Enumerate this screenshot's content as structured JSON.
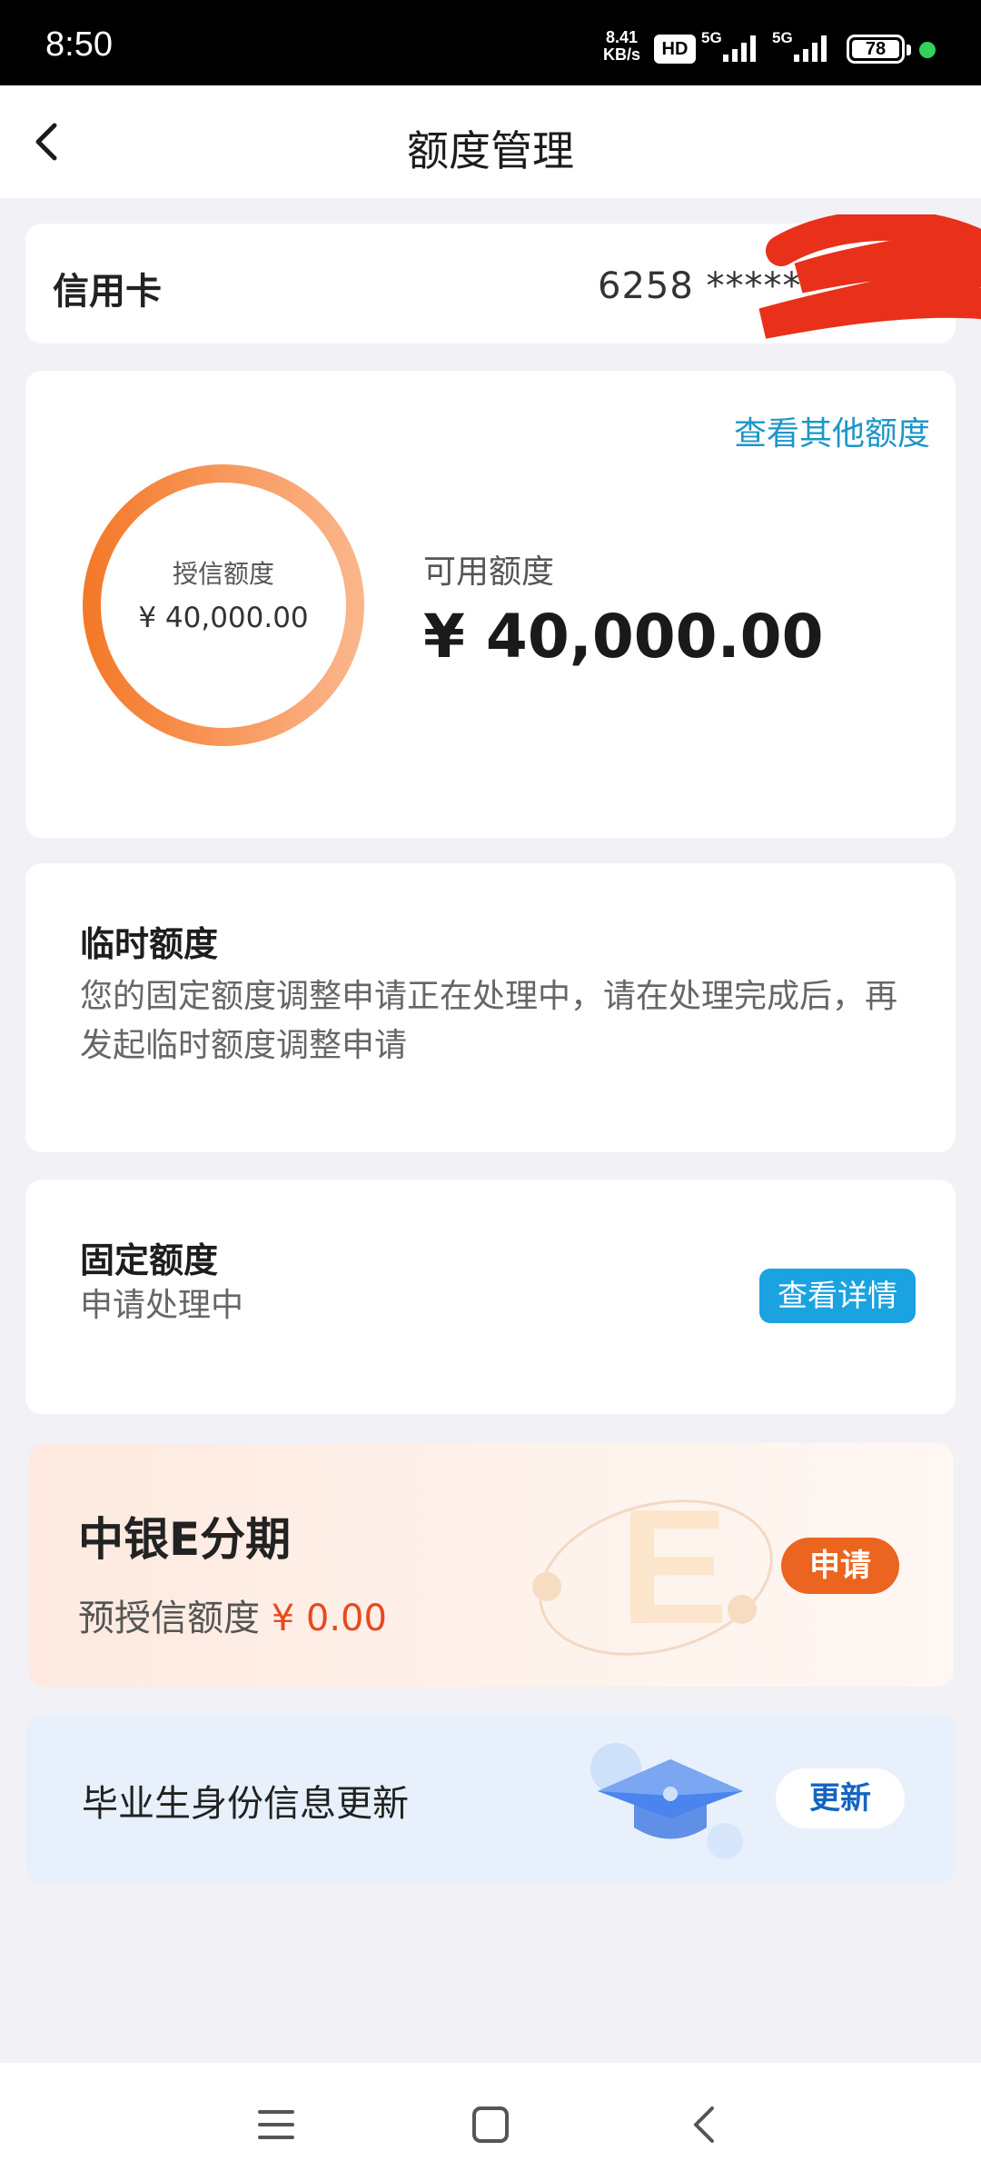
{
  "status_bar": {
    "time": "8:50",
    "net_speed_value": "8.41",
    "net_speed_unit": "KB/s",
    "hd_label": "HD",
    "signal1": "5G",
    "signal2": "5G",
    "battery": "78"
  },
  "header": {
    "title": "额度管理",
    "back_icon": "chevron-left-icon"
  },
  "account": {
    "label": "信用卡",
    "number": "6258 ******"
  },
  "quota": {
    "other_link": "查看其他额度",
    "credit_label": "授信额度",
    "credit_value": "¥ 40,000.00",
    "available_label": "可用额度",
    "available_value": "¥ 40,000.00",
    "ring_color": "#f58a3c"
  },
  "temporary": {
    "title": "临时额度",
    "description": "您的固定额度调整申请正在处理中，请在处理完成后，再发起临时额度调整申请"
  },
  "fixed": {
    "title": "固定额度",
    "status": "申请处理中",
    "detail_button": "查看详情"
  },
  "installment": {
    "title": "中银E分期",
    "pre_credit_label": "预授信额度",
    "pre_credit_value": "¥ 0.00",
    "apply_button": "申请"
  },
  "graduate": {
    "title": "毕业生身份信息更新",
    "update_button": "更新"
  },
  "nav": {
    "menu_icon": "menu-icon",
    "home_icon": "home-square-icon",
    "back_icon": "back-chevron-icon"
  }
}
